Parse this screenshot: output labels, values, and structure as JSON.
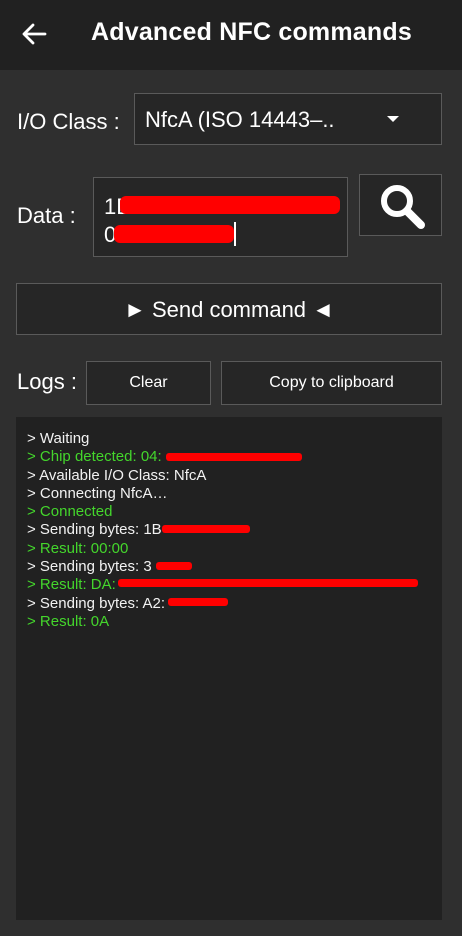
{
  "appbar": {
    "title": "Advanced NFC commands",
    "back_icon": "arrow-left-icon"
  },
  "io_class": {
    "label": "I/O Class :",
    "selected": "NfcA (ISO 14443–..",
    "dropdown_icon": "caret-down-icon"
  },
  "data": {
    "label": "Data :",
    "value_line1": "1B",
    "value_line2": "0"
  },
  "search": {
    "icon": "magnifier-icon"
  },
  "send": {
    "label": "► Send command ◄"
  },
  "logs": {
    "label": "Logs :",
    "clear_label": "Clear",
    "copy_label": "Copy to clipboard",
    "lines": [
      {
        "text": "> Waiting",
        "color": "white"
      },
      {
        "text": "> Chip detected: 04:",
        "color": "green"
      },
      {
        "text": "> Available I/O Class: NfcA",
        "color": "white"
      },
      {
        "text": "> Connecting NfcA…",
        "color": "white"
      },
      {
        "text": "> Connected",
        "color": "green"
      },
      {
        "text": "> Sending bytes: 1B",
        "color": "white"
      },
      {
        "text": "> Result: 00:00",
        "color": "green"
      },
      {
        "text": "> Sending bytes: 3",
        "color": "white"
      },
      {
        "text": "> Result: DA:",
        "color": "green"
      },
      {
        "text": "> Sending bytes: A2:",
        "color": "white"
      },
      {
        "text": "> Result: 0A",
        "color": "green"
      }
    ]
  },
  "colors": {
    "background": "#2f2f2f",
    "appbar": "#212121",
    "log_green": "#44d62c",
    "redaction": "#ff0000"
  }
}
